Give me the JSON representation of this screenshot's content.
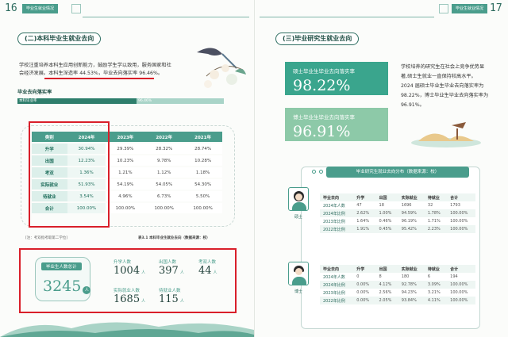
{
  "left_page": {
    "page_number": "16",
    "header_tag": "毕业生就业情况",
    "section_title": "(二)本科毕业生就业去向",
    "intro_lines": [
      "学校注重培养本科生应用创新能力，鼓励学生学以致用，服务国家和社",
      "会经济发展。本科生深造率 44.53%，毕业去向落实率 96.46%。"
    ],
    "rate_label": "毕业去向落实率",
    "bar_labels": [
      "本科毕业率",
      "96.46%"
    ],
    "table": {
      "headers": [
        "类别",
        "2024年",
        "2023年",
        "2022年",
        "2021年"
      ],
      "rows": [
        [
          "升学",
          "30.94%",
          "29.39%",
          "28.32%",
          "28.74%"
        ],
        [
          "出国",
          "12.23%",
          "10.23%",
          "9.78%",
          "10.28%"
        ],
        [
          "考双",
          "1.36%",
          "1.21%",
          "1.12%",
          "1.18%"
        ],
        [
          "实际就业",
          "51.93%",
          "54.19%",
          "54.05%",
          "54.30%"
        ],
        [
          "待就业",
          "3.54%",
          "4.96%",
          "6.73%",
          "5.50%"
        ],
        [
          "合计",
          "100.00%",
          "100.00%",
          "100.00%",
          "100.00%"
        ]
      ]
    },
    "caption_left": "[注：考双指考取第二学位]",
    "caption_right": "表3.1 本科毕业生就业去向（数据来源：校）",
    "total_label": "毕业生人数总计",
    "total_value": "3245",
    "unit": "人",
    "stats": [
      {
        "label": "升学人数",
        "value": "1004"
      },
      {
        "label": "出国人数",
        "value": "397"
      },
      {
        "label": "考双人数",
        "value": "44"
      },
      {
        "label": "实际就业人数",
        "value": "1685"
      },
      {
        "label": "待就业人数",
        "value": "115"
      }
    ]
  },
  "right_page": {
    "page_number": "17",
    "header_tag": "毕业生就业情况",
    "section_title": "(三)毕业研究生就业去向",
    "cards": [
      {
        "label": "硕士毕业生毕业去向落实率",
        "value": "98.22%",
        "color": "#3aa58d"
      },
      {
        "label": "博士毕业生毕业去向落实率",
        "value": "96.91%",
        "color": "#8dc9a8"
      }
    ],
    "intro_lines": [
      "学校培养的研究生在社会上竞争优势显",
      "著,硕士生就业一直保持较高水平。",
      "2024 届硕士毕业生毕业去向落实率为",
      "98.22%，博士毕业生毕业去向落实率为",
      "96.91%。"
    ],
    "panel_title": "毕业研究生就业去向分布（数据来源：校）",
    "table_headers": [
      "毕业去向",
      "升学",
      "出国",
      "实际就业",
      "待就业",
      "合计"
    ],
    "masters": {
      "label": "硕士",
      "rows": [
        [
          "2024年人数",
          "47",
          "18",
          "1696",
          "32",
          "1793"
        ],
        [
          "2024年比例",
          "2.62%",
          "1.00%",
          "94.59%",
          "1.78%",
          "100.00%"
        ],
        [
          "2023年比例",
          "1.64%",
          "0.46%",
          "96.19%",
          "1.71%",
          "100.00%"
        ],
        [
          "2022年比例",
          "1.91%",
          "0.45%",
          "95.42%",
          "2.23%",
          "100.00%"
        ]
      ]
    },
    "doctors": {
      "label": "博士",
      "rows": [
        [
          "2024年人数",
          "0",
          "8",
          "180",
          "6",
          "194"
        ],
        [
          "2024年比例",
          "0.00%",
          "4.12%",
          "92.78%",
          "3.09%",
          "100.00%"
        ],
        [
          "2023年比例",
          "0.00%",
          "2.56%",
          "94.23%",
          "3.21%",
          "100.00%"
        ],
        [
          "2022年比例",
          "0.00%",
          "2.05%",
          "93.84%",
          "4.11%",
          "100.00%"
        ]
      ]
    }
  },
  "colors": {
    "accent": "#4a9d8c",
    "dark": "#1f4f45",
    "highlight": "#d91f2a"
  }
}
